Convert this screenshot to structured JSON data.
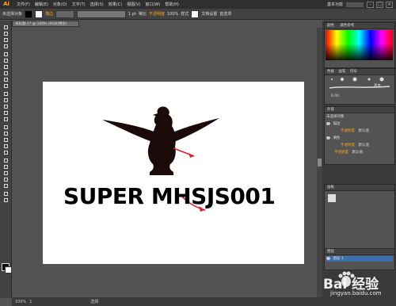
{
  "app": {
    "logo": "Ai"
  },
  "menu": [
    "文件(F)",
    "编辑(E)",
    "对象(O)",
    "文字(T)",
    "选择(S)",
    "效果(C)",
    "视图(V)",
    "窗口(W)",
    "帮助(H)"
  ],
  "menu_right": {
    "workspace": "基本功能",
    "search_placeholder": ""
  },
  "control_bar": {
    "selection_label": "未选择对象",
    "stroke_label": "描边",
    "stroke_value": "1 pt",
    "uniform": "等比",
    "opacity_label": "不透明度",
    "opacity_value": "100%",
    "style_label": "样式",
    "doc_setup": "文档设置",
    "preferences": "首选项"
  },
  "document_tab": {
    "title": "未标题-1* @ 100% (RGB/预览)"
  },
  "artboard": {
    "wordmark": "SUPER MHSJS001"
  },
  "status_bar": {
    "zoom": "100%",
    "page": "1",
    "tool": "选择"
  },
  "panels": {
    "color_tab": "颜色",
    "color_guide_tab": "颜色参考",
    "brushes_tabs": [
      "色板",
      "画笔",
      "符号"
    ],
    "brush_basic": "基本",
    "brush_size": "6.00",
    "appearance_title": "外观",
    "appearance_object": "未选择对象",
    "appearance_rows": [
      {
        "label": "描边",
        "value": ""
      },
      {
        "label": "不透明度",
        "value": "默认值"
      },
      {
        "label": "填色",
        "value": ""
      },
      {
        "label": "不透明度",
        "value": "默认值"
      },
      {
        "label": "不透明度",
        "value": "默认值"
      }
    ],
    "artboards_title": "画板",
    "layers_title": "图层",
    "layer_name": "图层 1",
    "layers_count": "1 个图层"
  },
  "watermark": {
    "brand": "Bai 经验",
    "url": "jingyan.baidu.com"
  },
  "colors": {
    "accent": "#f7a31b",
    "arrow": "#e0202a",
    "logo_fill": "#1a0a0a"
  }
}
